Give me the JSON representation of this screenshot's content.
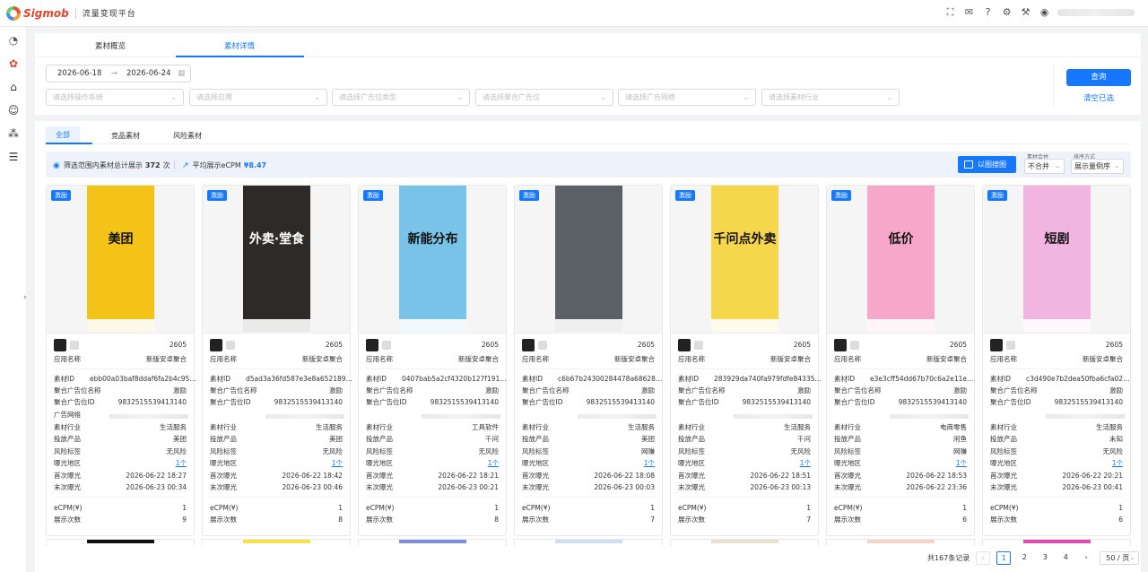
{
  "header": {
    "logo_text": "Sigmob",
    "platform_title": "流量变现平台",
    "icons": [
      "fullscreen-icon",
      "mail-icon",
      "help-icon",
      "settings-icon",
      "tool-icon",
      "user-icon"
    ]
  },
  "main_tabs": [
    "素材概览",
    "素材详情"
  ],
  "filters": {
    "date_start": "2026-06-18",
    "date_end": "2026-06-24",
    "os_placeholder": "请选择操作系统",
    "app_placeholder": "请选择应用",
    "ad_type_placeholder": "请选择广告位类型",
    "agg_slot_placeholder": "请选择聚合广告位",
    "network_placeholder": "请选择广告网络",
    "industry_placeholder": "请选择素材行业",
    "query_label": "查询",
    "clear_label": "清空已选"
  },
  "sub_tabs": [
    "全部",
    "竞品素材",
    "风险素材"
  ],
  "summary": {
    "total_prefix": "筛选范围内素材总计展示",
    "total_count": "372",
    "total_suffix": "次",
    "ecpm_label": "平均展示eCPM",
    "ecpm_value": "¥8.47",
    "image_search_label": "以图搜图",
    "merge_label": "素材合并",
    "merge_value": "不合并",
    "sort_label": "排序方式",
    "sort_value": "展示量倒序"
  },
  "labels": {
    "tag": "激励",
    "app_name": "应用名称",
    "material_id": "素材ID",
    "agg_slot_name": "聚合广告位名称",
    "agg_slot_id": "聚合广告位ID",
    "ad_network": "广告网络",
    "industry": "素材行业",
    "product": "投放产品",
    "risk": "风险标签",
    "region": "曝光地区",
    "first_seen": "首次曝光",
    "last_seen": "末次曝光",
    "ecpm": "eCPM(¥)",
    "impressions": "展示次数"
  },
  "cards": [
    {
      "num": "2605",
      "app": "新版安卓聚合",
      "id": "ebb00a03baf8ddaf6fa2b4c956b...",
      "slot_name": "激励",
      "slot_id": "9832515539413140",
      "industry": "生活服务",
      "product": "美团",
      "risk": "无风险",
      "region": "1个",
      "first": "2026-06-22 18:27",
      "last": "2026-06-23 00:34",
      "ecpm": "1",
      "imp": "9",
      "thumb_bg": "#f3c318",
      "thumb_text": "美团"
    },
    {
      "num": "2605",
      "app": "新版安卓聚合",
      "id": "d5ad3a36fd587e3e8a652189c5...",
      "slot_name": "激励",
      "slot_id": "9832515539413140",
      "industry": "生活服务",
      "product": "美团",
      "risk": "无风险",
      "region": "1个",
      "first": "2026-06-22 18:42",
      "last": "2026-06-23 00:46",
      "ecpm": "1",
      "imp": "8",
      "thumb_bg": "#2d2a27",
      "thumb_text": "外卖·堂食"
    },
    {
      "num": "2605",
      "app": "新版安卓聚合",
      "id": "0407bab5a2cf4320b127f191be19...",
      "slot_name": "激励",
      "slot_id": "9832515539413140",
      "industry": "工具软件",
      "product": "千问",
      "risk": "无风险",
      "region": "1个",
      "first": "2026-06-22 18:21",
      "last": "2026-06-23 00:21",
      "ecpm": "1",
      "imp": "8",
      "thumb_bg": "#7ac3e8",
      "thumb_text": "新能分布"
    },
    {
      "num": "2605",
      "app": "新版安卓聚合",
      "id": "c6b67b24300284478a686282c...",
      "slot_name": "激励",
      "slot_id": "9832515539413140",
      "industry": "生活服务",
      "product": "美团",
      "risk": "网赚",
      "region": "1个",
      "first": "2026-06-22 18:08",
      "last": "2026-06-23 00:03",
      "ecpm": "1",
      "imp": "7",
      "thumb_bg": "#5b5f66",
      "thumb_text": ""
    },
    {
      "num": "2605",
      "app": "新版安卓聚合",
      "id": "283929da740fa979fdfe8433566...",
      "slot_name": "激励",
      "slot_id": "9832515539413140",
      "industry": "生活服务",
      "product": "千问",
      "risk": "无风险",
      "region": "1个",
      "first": "2026-06-22 18:51",
      "last": "2026-06-23 00:13",
      "ecpm": "1",
      "imp": "7",
      "thumb_bg": "#f6d64a",
      "thumb_text": "千问点外卖"
    },
    {
      "num": "2605",
      "app": "新版安卓聚合",
      "id": "e3e3cff54dd67b70c6a2e11e7ca4...",
      "slot_name": "激励",
      "slot_id": "9832515539413140",
      "industry": "电商零售",
      "product": "闲鱼",
      "risk": "网赚",
      "region": "1个",
      "first": "2026-06-22 18:53",
      "last": "2026-06-22 23:36",
      "ecpm": "1",
      "imp": "6",
      "thumb_bg": "#f7a7c9",
      "thumb_text": "低价"
    },
    {
      "num": "2605",
      "app": "新版安卓聚合",
      "id": "c3d490e7b2dea50fba6cfa02356...",
      "slot_name": "激励",
      "slot_id": "9832515539413140",
      "industry": "生活服务",
      "product": "未知",
      "risk": "无风险",
      "region": "1个",
      "first": "2026-06-22 20:21",
      "last": "2026-06-23 00:41",
      "ecpm": "1",
      "imp": "6",
      "thumb_bg": "#f2b5e1",
      "thumb_text": "短剧"
    }
  ],
  "pagination": {
    "total": "共167条记录",
    "pages": [
      "1",
      "2",
      "3",
      "4"
    ],
    "page_size": "50 / 页"
  }
}
